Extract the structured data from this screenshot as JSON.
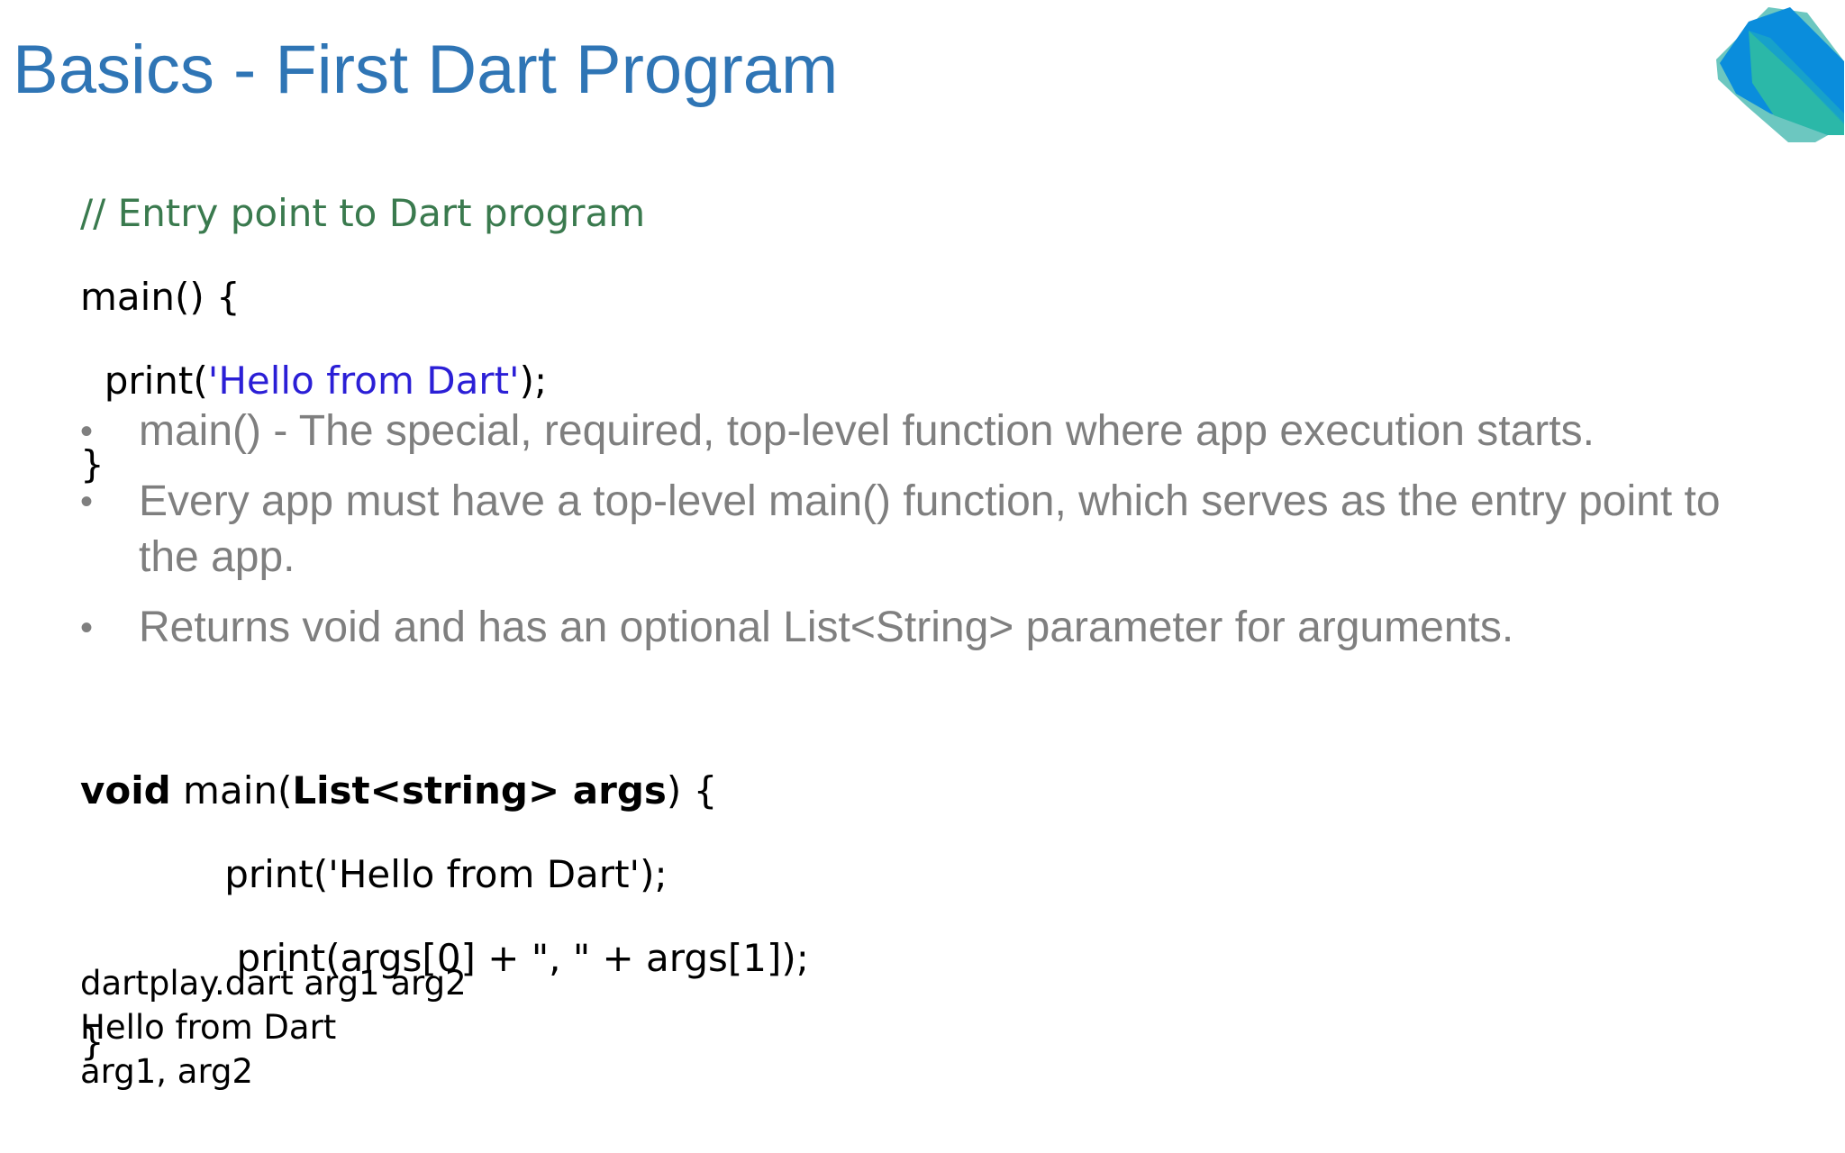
{
  "slide": {
    "title": "Basics - First Dart Program",
    "logo_icon": "dart-logo-icon",
    "brand_colors": {
      "title": "#2f75b5",
      "comment": "#3a7a4e",
      "string": "#2b1fd6",
      "bullet_text": "#7f7f7f"
    }
  },
  "code_block_1": {
    "comment": "// Entry point to Dart program",
    "line_main": "main() {",
    "print_open": "  print(",
    "print_string": "'Hello from Dart'",
    "print_close": ");",
    "closing_brace": "}"
  },
  "bullets": [
    "main() - The special, required, top-level function where app execution starts.",
    "Every app must have a top-level main() function, which serves as the entry point to the app.",
    "Returns void and has an optional List<String> parameter for arguments."
  ],
  "bullet_symbol": "•",
  "code_block_2": {
    "kw_void": "void",
    "main_open": " main(",
    "param": "List<string> args",
    "main_close": ") {",
    "print_1": "            print('Hello from Dart');",
    "print_2": "             print(args[0] + \", \" + args[1]);",
    "closing_brace": "}"
  },
  "output": {
    "lines": [
      "dartplay.dart arg1 arg2",
      "Hello from Dart",
      "arg1, arg2"
    ]
  }
}
